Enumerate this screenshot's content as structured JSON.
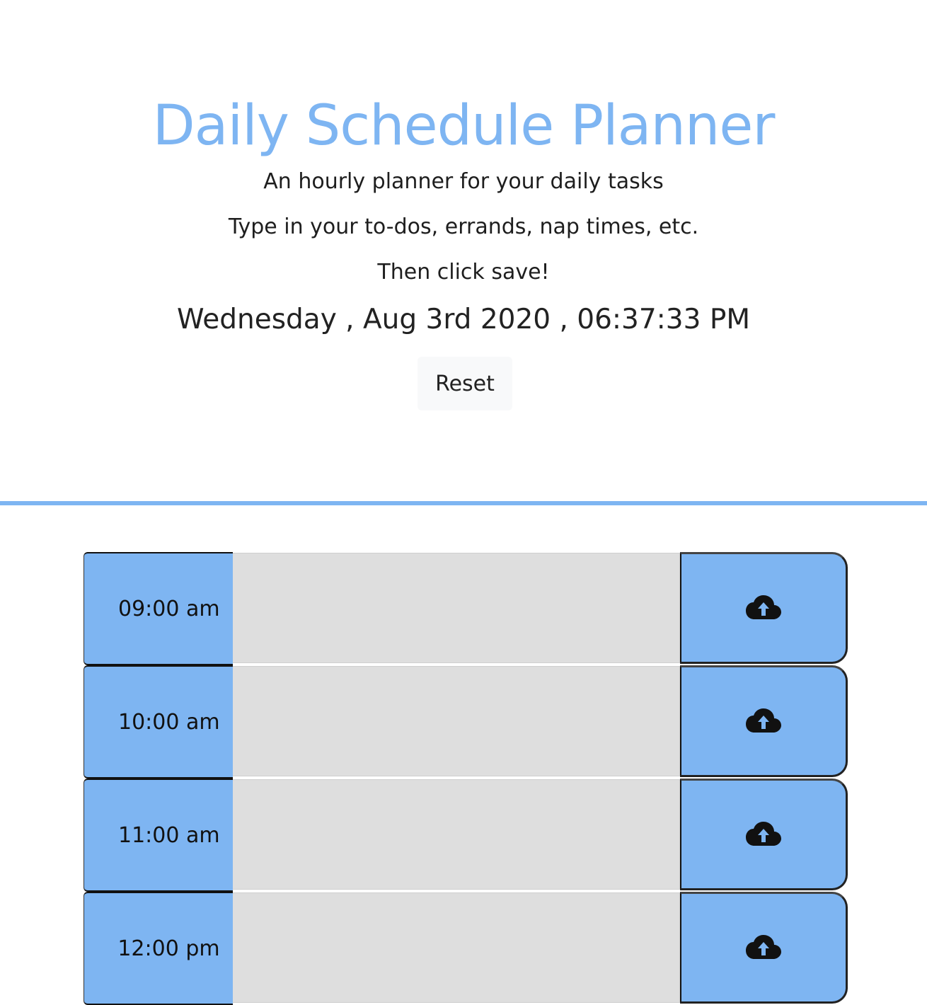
{
  "header": {
    "title": "Daily Schedule Planner",
    "lead_lines": [
      "An hourly planner for your daily tasks",
      "Type in your to-dos, errands, nap times, etc.",
      "Then click save!"
    ],
    "current_day": "Wednesday , Aug 3rd 2020 , 06:37:33 PM",
    "reset_label": "Reset"
  },
  "colors": {
    "accent": "#7eb5f2",
    "textarea_bg": "#dedede"
  },
  "time_blocks": [
    {
      "hour": "09:00 am",
      "description": "",
      "save_icon": "cloud-upload-icon"
    },
    {
      "hour": "10:00 am",
      "description": "",
      "save_icon": "cloud-upload-icon"
    },
    {
      "hour": "11:00 am",
      "description": "",
      "save_icon": "cloud-upload-icon"
    },
    {
      "hour": "12:00 pm",
      "description": "",
      "save_icon": "cloud-upload-icon"
    }
  ]
}
